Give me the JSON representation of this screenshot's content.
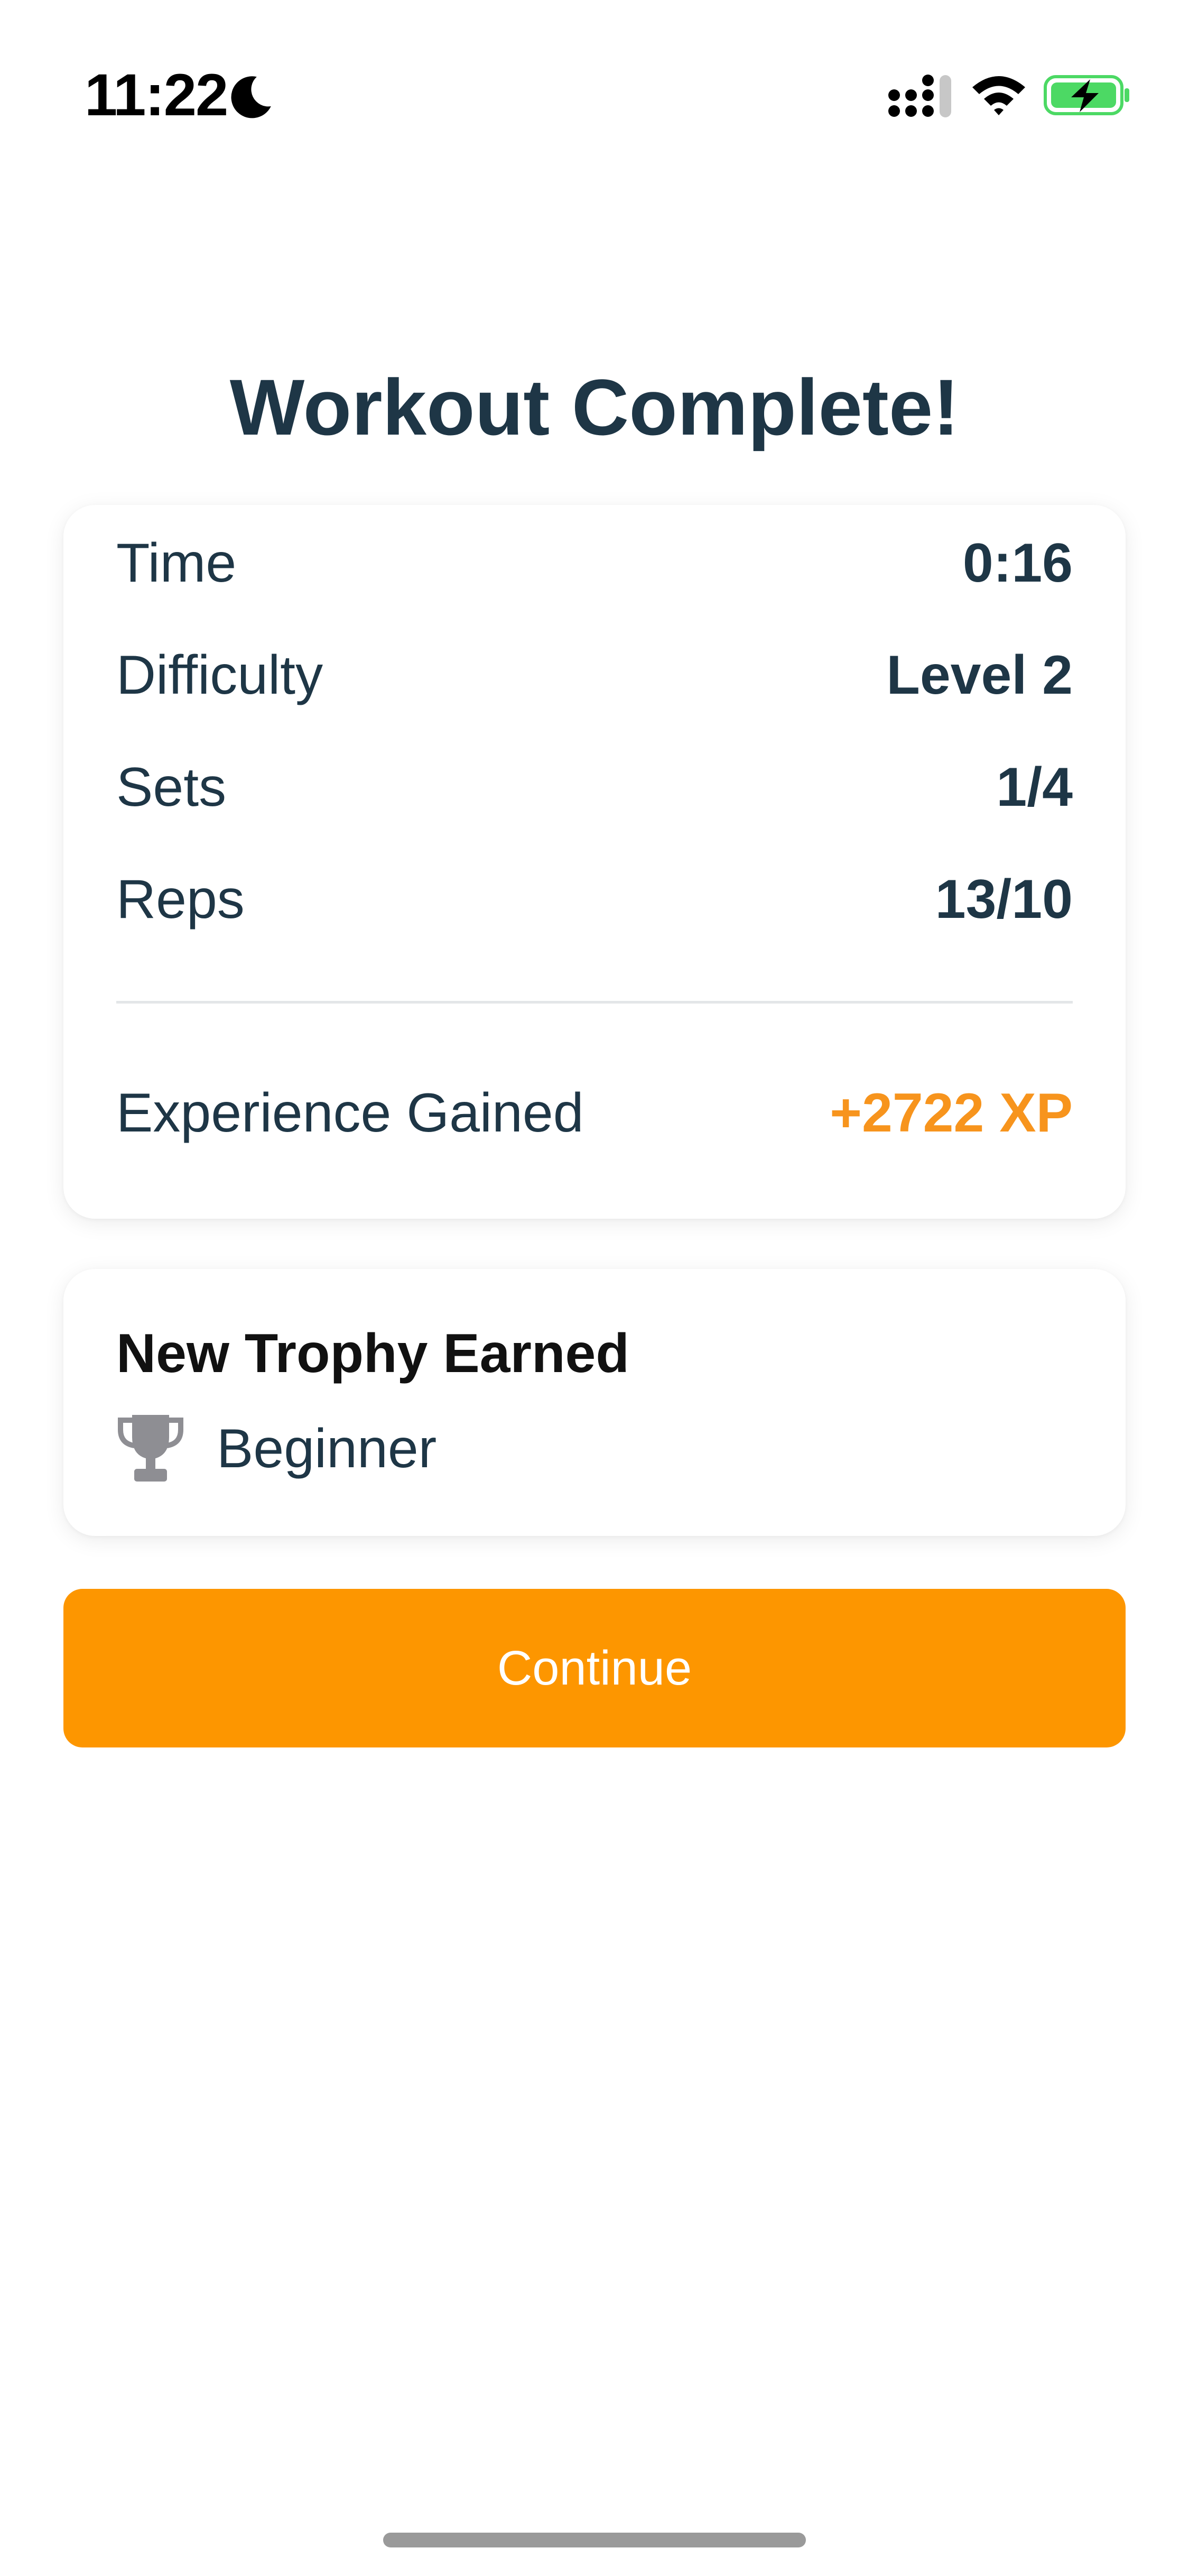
{
  "status_bar": {
    "time": "11:22",
    "icons": [
      "moon-icon",
      "signal-icon",
      "wifi-icon",
      "battery-charging-icon"
    ],
    "battery_color": "#4cd964"
  },
  "title": "Workout Complete!",
  "stats": {
    "time_label": "Time",
    "time_value": "0:16",
    "difficulty_label": "Difficulty",
    "difficulty_value": "Level 2",
    "sets_label": "Sets",
    "sets_value": "1/4",
    "reps_label": "Reps",
    "reps_value": "13/10",
    "xp_label": "Experience Gained",
    "xp_value": "+2722 XP",
    "xp_color": "#f7941d"
  },
  "trophy": {
    "heading": "New Trophy Earned",
    "icon": "trophy-icon",
    "name": "Beginner"
  },
  "continue_button": {
    "label": "Continue",
    "color": "#fd9600"
  }
}
